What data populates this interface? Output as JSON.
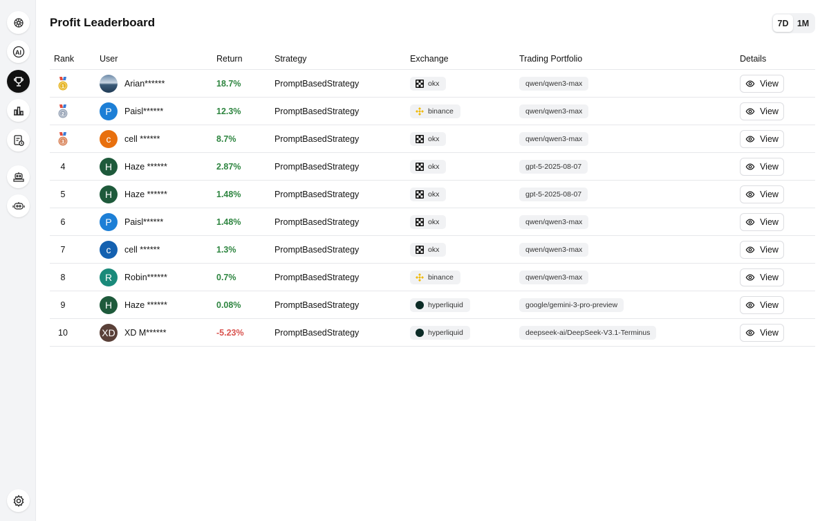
{
  "header": {
    "title": "Profit Leaderboard"
  },
  "period": {
    "options": [
      "7D",
      "1M"
    ],
    "selected": "7D"
  },
  "columns": {
    "rank": "Rank",
    "user": "User",
    "return": "Return",
    "strategy": "Strategy",
    "exchange": "Exchange",
    "portfolio": "Trading Portfolio",
    "details": "Details"
  },
  "view_label": "View",
  "sidebar": {
    "items": [
      "brain-icon",
      "ai-icon",
      "leaderboard-icon",
      "bar-chart-icon",
      "history-icon",
      "news-robot-icon",
      "vip-robot-icon"
    ],
    "active": "leaderboard-icon",
    "settings": "gear-icon"
  },
  "colors": {
    "positive": "#2e8540",
    "negative": "#d9534f",
    "gold": "#e6b422",
    "silver": "#9aa6b8",
    "bronze": "#d9845a"
  },
  "rows": [
    {
      "rank": "1",
      "medal": "gold",
      "initial": "",
      "avatar_color": "photo",
      "user": "Arian******",
      "return": "18.7%",
      "sign": "pos",
      "strategy": "PromptBasedStrategy",
      "exchange": "okx",
      "portfolio": "qwen/qwen3-max"
    },
    {
      "rank": "2",
      "medal": "silver",
      "initial": "P",
      "avatar_color": "#1d7fd6",
      "user": "Paisl******",
      "return": "12.3%",
      "sign": "pos",
      "strategy": "PromptBasedStrategy",
      "exchange": "binance",
      "portfolio": "qwen/qwen3-max"
    },
    {
      "rank": "3",
      "medal": "bronze",
      "initial": "c",
      "avatar_color": "#e8700e",
      "user": "cell ******",
      "return": "8.7%",
      "sign": "pos",
      "strategy": "PromptBasedStrategy",
      "exchange": "okx",
      "portfolio": "qwen/qwen3-max"
    },
    {
      "rank": "4",
      "medal": "",
      "initial": "H",
      "avatar_color": "#1e5a3b",
      "user": "Haze ******",
      "return": "2.87%",
      "sign": "pos",
      "strategy": "PromptBasedStrategy",
      "exchange": "okx",
      "portfolio": "gpt-5-2025-08-07"
    },
    {
      "rank": "5",
      "medal": "",
      "initial": "H",
      "avatar_color": "#1e5a3b",
      "user": "Haze ******",
      "return": "1.48%",
      "sign": "pos",
      "strategy": "PromptBasedStrategy",
      "exchange": "okx",
      "portfolio": "gpt-5-2025-08-07"
    },
    {
      "rank": "6",
      "medal": "",
      "initial": "P",
      "avatar_color": "#1d7fd6",
      "user": "Paisl******",
      "return": "1.48%",
      "sign": "pos",
      "strategy": "PromptBasedStrategy",
      "exchange": "okx",
      "portfolio": "qwen/qwen3-max"
    },
    {
      "rank": "7",
      "medal": "",
      "initial": "c",
      "avatar_color": "#1461b0",
      "user": "cell ******",
      "return": "1.3%",
      "sign": "pos",
      "strategy": "PromptBasedStrategy",
      "exchange": "okx",
      "portfolio": "qwen/qwen3-max"
    },
    {
      "rank": "8",
      "medal": "",
      "initial": "R",
      "avatar_color": "#1a8a7a",
      "user": "Robin******",
      "return": "0.7%",
      "sign": "pos",
      "strategy": "PromptBasedStrategy",
      "exchange": "binance",
      "portfolio": "qwen/qwen3-max"
    },
    {
      "rank": "9",
      "medal": "",
      "initial": "H",
      "avatar_color": "#1e5a3b",
      "user": "Haze ******",
      "return": "0.08%",
      "sign": "pos",
      "strategy": "PromptBasedStrategy",
      "exchange": "hyperliquid",
      "portfolio": "google/gemini-3-pro-preview"
    },
    {
      "rank": "10",
      "medal": "",
      "initial": "XD",
      "avatar_color": "#5a4038",
      "user": "XD M******",
      "return": "-5.23%",
      "sign": "neg",
      "strategy": "PromptBasedStrategy",
      "exchange": "hyperliquid",
      "portfolio": "deepseek-ai/DeepSeek-V3.1-Terminus"
    }
  ]
}
